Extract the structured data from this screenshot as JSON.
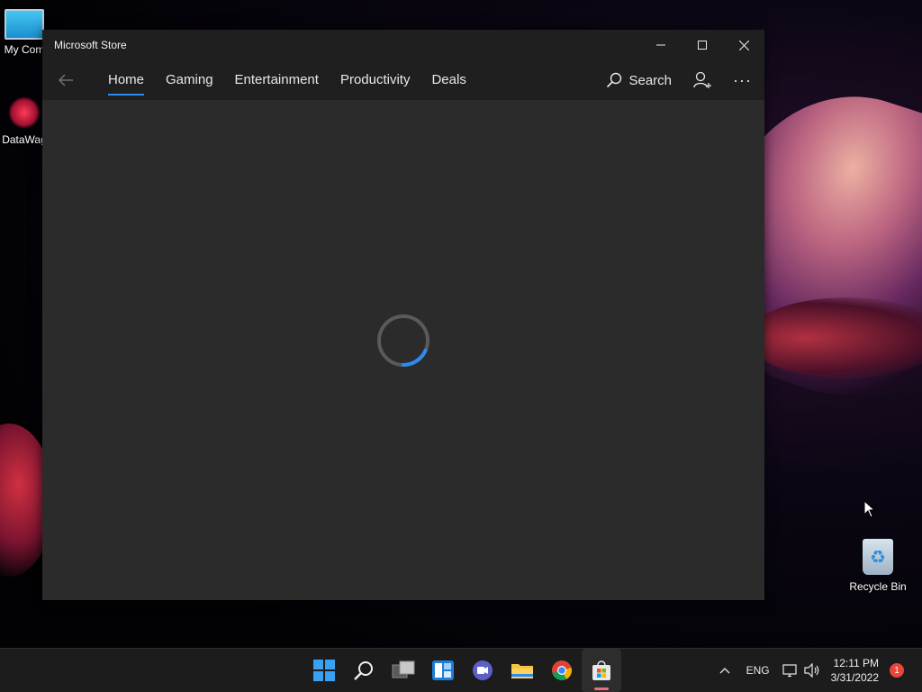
{
  "desktop": {
    "icons": [
      {
        "label": "My Com"
      },
      {
        "label": "DataWag"
      },
      {
        "label": "Recycle Bin"
      }
    ]
  },
  "window": {
    "title": "Microsoft Store",
    "nav": {
      "tabs": [
        {
          "label": "Home",
          "active": true
        },
        {
          "label": "Gaming"
        },
        {
          "label": "Entertainment"
        },
        {
          "label": "Productivity"
        },
        {
          "label": "Deals"
        }
      ],
      "search_label": "Search"
    },
    "loading": true
  },
  "taskbar": {
    "tray": {
      "language": "ENG",
      "time": "12:11 PM",
      "date": "3/31/2022",
      "notification_count": "1"
    }
  },
  "colors": {
    "accent": "#2a8cf0",
    "window_bg": "#2b2b2b",
    "titlebar_bg": "#1f1f1f",
    "taskbar_bg": "#1c1c1c"
  }
}
